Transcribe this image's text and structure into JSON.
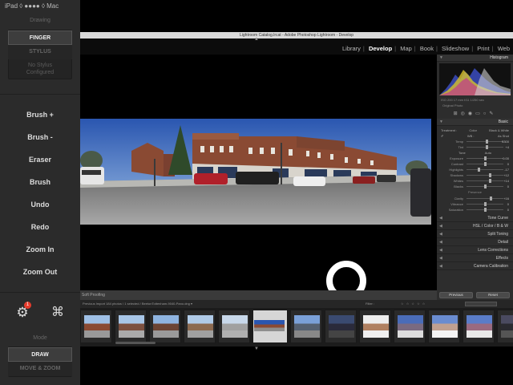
{
  "sidebar": {
    "status": "iPad ◊ ●●●● ◊ Mac",
    "drawing_label": "Drawing",
    "finger_label": "FINGER",
    "stylus_label": "STYLUS",
    "no_stylus_line1": "No Stylus",
    "no_stylus_line2": "Configured",
    "commands": [
      "Brush +",
      "Brush -",
      "Eraser",
      "Brush",
      "Undo",
      "Redo",
      "Zoom In",
      "Zoom Out"
    ],
    "settings_badge": "1",
    "mode_label": "Mode",
    "draw_label": "DRAW",
    "move_zoom_label": "MOVE & ZOOM"
  },
  "lightroom": {
    "window_title": "Lightroom Catalog.lrcat - Adobe Photoshop Lightroom - Develop",
    "modules": [
      "Library",
      "Develop",
      "Map",
      "Book",
      "Slideshow",
      "Print",
      "Web"
    ],
    "active_module": "Develop",
    "panels": {
      "histogram_title": "Histogram",
      "histogram_readout": "ISO 200    17 mm    f/11    1/250 sec",
      "original_photo": "Original Photo",
      "basic_title": "Basic",
      "treatment_label": "Treatment :",
      "treatment_color": "Color",
      "treatment_bw": "Black & White",
      "wb_label": "WB :",
      "wb_value": "As Shot",
      "tone_label": "Tone",
      "tone_auto": "Auto",
      "presence_label": "Presence",
      "temp_rows": [
        {
          "label": "Temp",
          "value": "5300"
        },
        {
          "label": "Tint",
          "value": "+4"
        }
      ],
      "tone_rows": [
        {
          "label": "Exposure",
          "value": "0.00"
        },
        {
          "label": "Contrast",
          "value": "0"
        },
        {
          "label": "Highlights",
          "value": "-17"
        },
        {
          "label": "Shadows",
          "value": "+12"
        },
        {
          "label": "Whites",
          "value": "+14"
        },
        {
          "label": "Blacks",
          "value": "0"
        }
      ],
      "presence_rows": [
        {
          "label": "Clarity",
          "value": "+16"
        },
        {
          "label": "Vibrance",
          "value": "0"
        },
        {
          "label": "Saturation",
          "value": "0"
        }
      ],
      "collapsed": [
        "Tone Curve",
        "HSL / Color / B & W",
        "Split Toning",
        "Detail",
        "Lens Corrections",
        "Effects",
        "Camera Calibration"
      ],
      "previous_label": "Previous",
      "reset_label": "Reset"
    },
    "toolbar_label": "Soft Proofing",
    "filmstrip_info": "Previous Import    184 photos / 1 selected / BeetonTottenham-9040-Pano.dng ▾",
    "filter_label": "Filter :",
    "filter_stars": "☆ ☆ ☆ ☆ ☆",
    "filter_preset": "Filters Off",
    "thumb_count": 13,
    "selected_thumb": 5
  },
  "colors": {
    "sky_top": "#2a56b0",
    "sky_bottom": "#9fc0e6",
    "brick": "#8a4a33",
    "road": "#8e8e8e",
    "badge": "#e53b2c"
  }
}
